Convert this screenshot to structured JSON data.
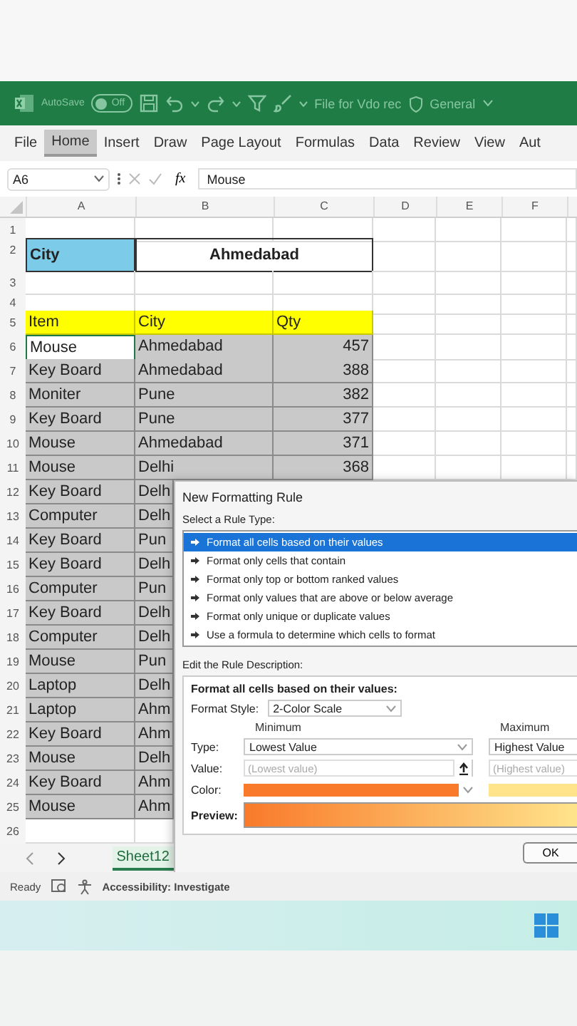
{
  "title_bar": {
    "autosave_label": "AutoSave",
    "autosave_on": false,
    "autosave_state": "Off",
    "file_name": "File for Vdo rec",
    "sensitivity": "General"
  },
  "ribbon_tabs": [
    {
      "label": "File",
      "selected": false
    },
    {
      "label": "Home",
      "selected": true
    },
    {
      "label": "Insert",
      "selected": false
    },
    {
      "label": "Draw",
      "selected": false
    },
    {
      "label": "Page Layout",
      "selected": false
    },
    {
      "label": "Formulas",
      "selected": false
    },
    {
      "label": "Data",
      "selected": false
    },
    {
      "label": "Review",
      "selected": false
    },
    {
      "label": "View",
      "selected": false
    },
    {
      "label": "Aut",
      "selected": false
    }
  ],
  "formula_bar": {
    "name_box": "A6",
    "fx": "fx",
    "value": "Mouse"
  },
  "sheet": {
    "columns": [
      "A",
      "B",
      "C",
      "D",
      "E",
      "F"
    ],
    "rows": [
      {
        "number": "1",
        "kind": "blank"
      },
      {
        "number": "2",
        "kind": "title",
        "a": "City",
        "b": "Ahmedabad"
      },
      {
        "number": "3",
        "kind": "blank"
      },
      {
        "number": "4",
        "kind": "blank"
      },
      {
        "number": "5",
        "kind": "header",
        "a": "Item",
        "b": "City",
        "c": "Qty"
      }
    ],
    "data_rows": [
      {
        "number": "6",
        "a": "Mouse",
        "b": "Ahmedabad",
        "c": "457",
        "selected": true,
        "active": true
      },
      {
        "number": "7",
        "a": "Key Board",
        "b": "Ahmedabad",
        "c": "388",
        "selected": true,
        "active": false
      },
      {
        "number": "8",
        "a": "Moniter",
        "b": "Pune",
        "c": "382",
        "selected": true,
        "active": false
      },
      {
        "number": "9",
        "a": "Key Board",
        "b": "Pune",
        "c": "377",
        "selected": true,
        "active": false
      },
      {
        "number": "10",
        "a": "Mouse",
        "b": "Ahmedabad",
        "c": "371",
        "selected": true,
        "active": false
      },
      {
        "number": "11",
        "a": "Mouse",
        "b": "Delhi",
        "c": "368",
        "selected": true,
        "active": false
      }
    ],
    "covered_rows": [
      {
        "number": "12",
        "a": "Key Board",
        "b": "Delh",
        "selected": true
      },
      {
        "number": "13",
        "a": "Computer",
        "b": "Delh",
        "selected": true
      },
      {
        "number": "14",
        "a": "Key Board",
        "b": "Pun",
        "selected": true
      },
      {
        "number": "15",
        "a": "Key Board",
        "b": "Delh",
        "selected": true
      },
      {
        "number": "16",
        "a": "Computer",
        "b": "Pun",
        "selected": true
      },
      {
        "number": "17",
        "a": "Key Board",
        "b": "Delh",
        "selected": true
      },
      {
        "number": "18",
        "a": "Computer",
        "b": "Delh",
        "selected": true
      },
      {
        "number": "19",
        "a": "Mouse",
        "b": "Pun",
        "selected": true
      },
      {
        "number": "20",
        "a": "Laptop",
        "b": "Delh",
        "selected": true
      },
      {
        "number": "21",
        "a": "Laptop",
        "b": "Ahm",
        "selected": true
      },
      {
        "number": "22",
        "a": "Key Board",
        "b": "Ahm",
        "selected": true
      },
      {
        "number": "23",
        "a": "Mouse",
        "b": "Delh",
        "selected": true
      },
      {
        "number": "24",
        "a": "Key Board",
        "b": "Ahm",
        "selected": true
      },
      {
        "number": "25",
        "a": "Mouse",
        "b": "Ahm",
        "selected": true
      }
    ],
    "blank_row": {
      "number": "26"
    }
  },
  "sheet_tabs": [
    {
      "label": "Sheet12",
      "selected": true
    }
  ],
  "dialog": {
    "title": "New Formatting Rule",
    "rule_type_label": "Select a Rule Type:",
    "rule_types": [
      {
        "label": "Format all cells based on their values",
        "selected": true
      },
      {
        "label": "Format only cells that contain",
        "selected": false
      },
      {
        "label": "Format only top or bottom ranked values",
        "selected": false
      },
      {
        "label": "Format only values that are above or below average",
        "selected": false
      },
      {
        "label": "Format only unique or duplicate values",
        "selected": false
      },
      {
        "label": "Use a formula to determine which cells to format",
        "selected": false
      }
    ],
    "description_label": "Edit the Rule Description:",
    "description_heading": "Format all cells based on their values:",
    "format_style_label": "Format Style:",
    "format_style": "2-Color Scale",
    "type_label": "Type:",
    "value_label": "Value:",
    "color_label": "Color:",
    "scale_points": [
      {
        "heading": "Minimum",
        "type": "Lowest Value",
        "placeholder": "(Lowest value)",
        "color": "#f97a2a"
      },
      {
        "heading": "Maximum",
        "type": "Highest Value",
        "placeholder": "(Highest value)",
        "color": "#ffe48c"
      }
    ],
    "preview_label": "Preview:",
    "ok": "OK"
  },
  "status_bar": {
    "ready": "Ready",
    "accessibility": "Accessibility: Investigate"
  }
}
